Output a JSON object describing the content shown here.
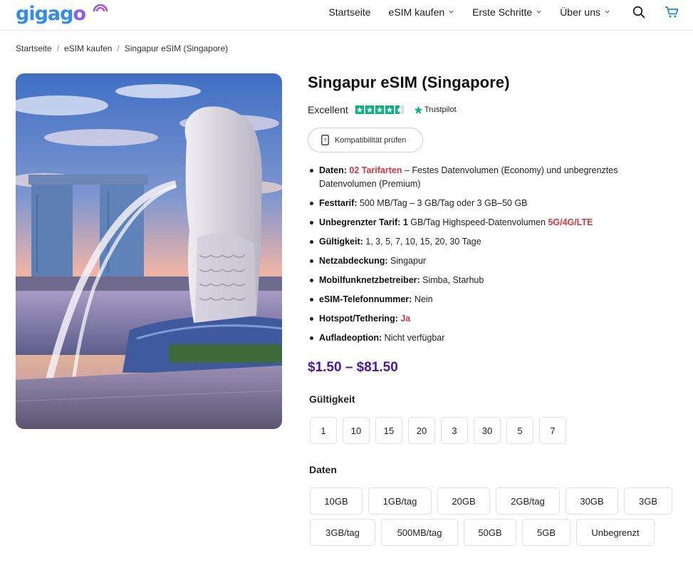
{
  "header": {
    "logo_text": "gigago",
    "nav": [
      {
        "label": "Startseite",
        "has_dropdown": false
      },
      {
        "label": "eSIM kaufen",
        "has_dropdown": true
      },
      {
        "label": "Erste Schritte",
        "has_dropdown": true
      },
      {
        "label": "Über uns",
        "has_dropdown": true
      }
    ],
    "icons": [
      "search-icon",
      "cart-icon"
    ]
  },
  "breadcrumb": [
    "Startseite",
    "eSIM kaufen",
    "Singapur eSIM (Singapore)"
  ],
  "product": {
    "title": "Singapur eSIM (Singapore)",
    "rating_label": "Excellent",
    "rating_stars": 4.5,
    "trustpilot_label": "Trustpilot",
    "compat_button": "Kompatibilität prüfen",
    "specs": [
      {
        "key": "Daten:",
        "highlight": "02 Tarifarten",
        "text": " – Festes Datenvolumen (Economy) und unbegrenztes Datenvolumen (Premium)"
      },
      {
        "key": "Festtarif:",
        "text": " 500 MB/Tag – 3 GB/Tag oder 3 GB–50 GB"
      },
      {
        "key": "Unbegrenzter Tarif: 1",
        "text": " GB/Tag Highspeed-Datenvolumen ",
        "highlight_end": "5G/4G/LTE"
      },
      {
        "key": "Gültigkeit:",
        "text": " 1, 3, 5, 7, 10, 15, 20, 30 Tage"
      },
      {
        "key": "Netzabdeckung:",
        "text": " Singapur"
      },
      {
        "key": "Mobilfunknetzbetreiber:",
        "text": " Simba, Starhub"
      },
      {
        "key": "eSIM-Telefonnummer:",
        "text": " Nein"
      },
      {
        "key": "Hotspot/Tethering:",
        "text": " ",
        "highlight_end": "Ja"
      },
      {
        "key": "Aufladeoption:",
        "text": " Nicht verfügbar"
      }
    ],
    "price": "$1.50 – $81.50",
    "validity_label": "Gültigkeit",
    "validity_options": [
      "1",
      "10",
      "15",
      "20",
      "3",
      "30",
      "5",
      "7"
    ],
    "data_label": "Daten",
    "data_options_row1": [
      "10GB",
      "1GB/tag",
      "20GB",
      "2GB/tag",
      "30GB",
      "3GB"
    ],
    "data_options_row2": [
      "3GB/tag",
      "500MB/tag",
      "50GB",
      "5GB",
      "Unbegrenzt"
    ]
  },
  "colors": {
    "accent_price": "#4a18a8",
    "highlight_red": "#d9363e",
    "trustpilot_green": "#00b67a",
    "logo_blue": "#2f8cf0",
    "logo_purple": "#8a5cf6"
  }
}
